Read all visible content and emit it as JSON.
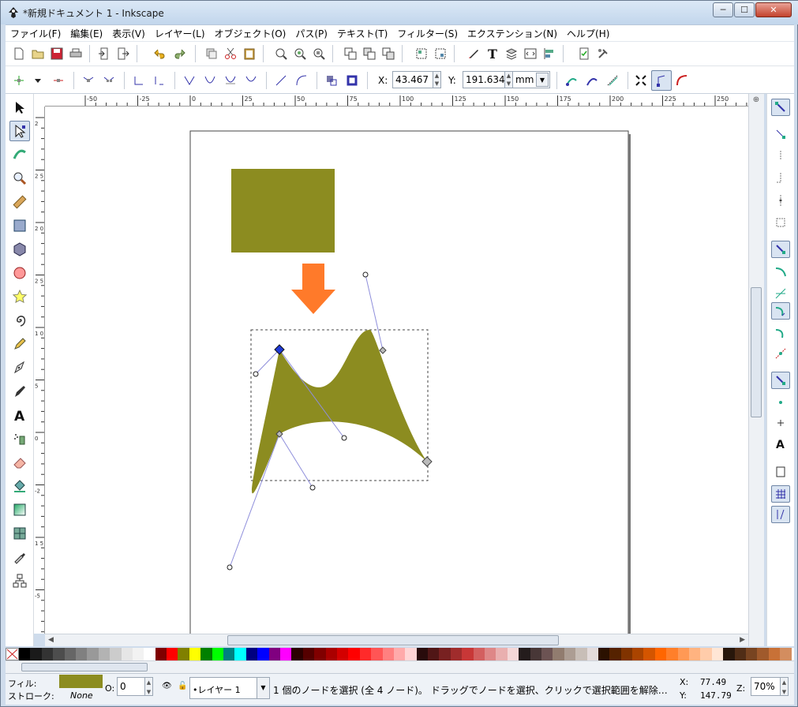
{
  "window": {
    "title": "*新規ドキュメント 1 - Inkscape",
    "min": "─",
    "max": "☐",
    "close": "✕"
  },
  "menu": [
    "ファイル(F)",
    "編集(E)",
    "表示(V)",
    "レイヤー(L)",
    "オブジェクト(O)",
    "パス(P)",
    "テキスト(T)",
    "フィルター(S)",
    "エクステンション(N)",
    "ヘルプ(H)"
  ],
  "controls": {
    "x_label": "X:",
    "x_value": "43.467",
    "y_label": "Y:",
    "y_value": "191.634",
    "unit": "mm"
  },
  "rulers": {
    "h_ticks": [
      "-50",
      "-25",
      "0",
      "25",
      "50",
      "75",
      "100",
      "125",
      "150",
      "175",
      "200",
      "225",
      "250"
    ],
    "v_ticks": [
      "2",
      "2 5",
      "2 0",
      "2 5",
      "1 0",
      "5",
      "0",
      "-2",
      "1 5",
      "-5",
      "0",
      "5"
    ]
  },
  "colors": {
    "shape_fill": "#8c8c20",
    "arrow": "#ff7a2a",
    "node_selected": "#1f3ad6",
    "handle_line": "#8e8edb"
  },
  "palette": [
    "#000000",
    "#1a1a1a",
    "#333333",
    "#4d4d4d",
    "#666666",
    "#808080",
    "#999999",
    "#b3b3b3",
    "#cccccc",
    "#e6e6e6",
    "#f2f2f2",
    "#ffffff",
    "#800000",
    "#ff0000",
    "#808000",
    "#ffff00",
    "#008000",
    "#00ff00",
    "#008080",
    "#00ffff",
    "#000080",
    "#0000ff",
    "#800080",
    "#ff00ff",
    "#2b0000",
    "#550000",
    "#800000",
    "#aa0000",
    "#d40000",
    "#ff0000",
    "#ff2a2a",
    "#ff5555",
    "#ff8080",
    "#ffaaaa",
    "#ffd5d5",
    "#280b0b",
    "#501616",
    "#782121",
    "#a02c2c",
    "#c83737",
    "#d35f5f",
    "#de8787",
    "#e9afaf",
    "#f4d7d7",
    "#241c1c",
    "#483737",
    "#6c5353",
    "#917c6f",
    "#ac9d93",
    "#c8beb7",
    "#e3dbdb",
    "#2b1100",
    "#552200",
    "#803300",
    "#aa4400",
    "#d45500",
    "#ff6600",
    "#ff7f2a",
    "#ff9955",
    "#ffb380",
    "#ffccaa",
    "#ffe6d5",
    "#28170b",
    "#502d16",
    "#784421",
    "#a05a2c",
    "#c87137",
    "#d38d5f"
  ],
  "status": {
    "fill_label": "フィル:",
    "stroke_label": "ストローク:",
    "stroke_value": "None",
    "opacity_label": "O:",
    "opacity_value": "0",
    "layer": "•レイヤー 1",
    "message": "1 個のノードを選択 (全 4 ノード)。 ドラッグでノードを選択、クリックで選択範囲を解除…",
    "cursor_x_label": "X:",
    "cursor_x": "77.49",
    "cursor_y_label": "Y:",
    "cursor_y": "147.79",
    "zoom_label": "Z:",
    "zoom": "70%"
  }
}
